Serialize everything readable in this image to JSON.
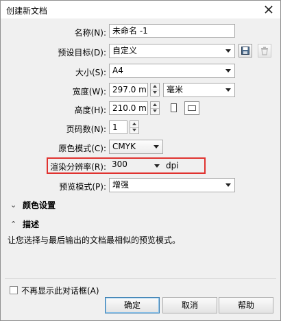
{
  "window": {
    "title": "创建新文档"
  },
  "form": {
    "name": {
      "label": "名称(N):",
      "value": "未命名 -1"
    },
    "preset": {
      "label": "预设目标(D):",
      "value": "自定义"
    },
    "size": {
      "label": "大小(S):",
      "value": "A4"
    },
    "width": {
      "label": "宽度(W):",
      "value": "297.0 mm",
      "unit": "毫米"
    },
    "height": {
      "label": "高度(H):",
      "value": "210.0 mm"
    },
    "pages": {
      "label": "页码数(N):",
      "value": "1"
    },
    "color_mode": {
      "label": "原色模式(C):",
      "value": "CMYK"
    },
    "resolution": {
      "label": "渲染分辨率(R):",
      "value": "300",
      "unit": "dpi"
    },
    "preview_mode": {
      "label": "预览模式(P):",
      "value": "增强"
    }
  },
  "sections": {
    "color_settings": {
      "label": "颜色设置",
      "expanded": false
    },
    "description": {
      "label": "描述",
      "expanded": true,
      "text": "让您选择与最后输出的文档最相似的预览模式。"
    }
  },
  "footer": {
    "dont_show": {
      "label": "不再显示此对话框(A)",
      "checked": false
    },
    "ok": "确定",
    "cancel": "取消",
    "help": "帮助"
  },
  "colors": {
    "highlight": "#e0322f",
    "default_button_border": "#3c7fb1"
  }
}
